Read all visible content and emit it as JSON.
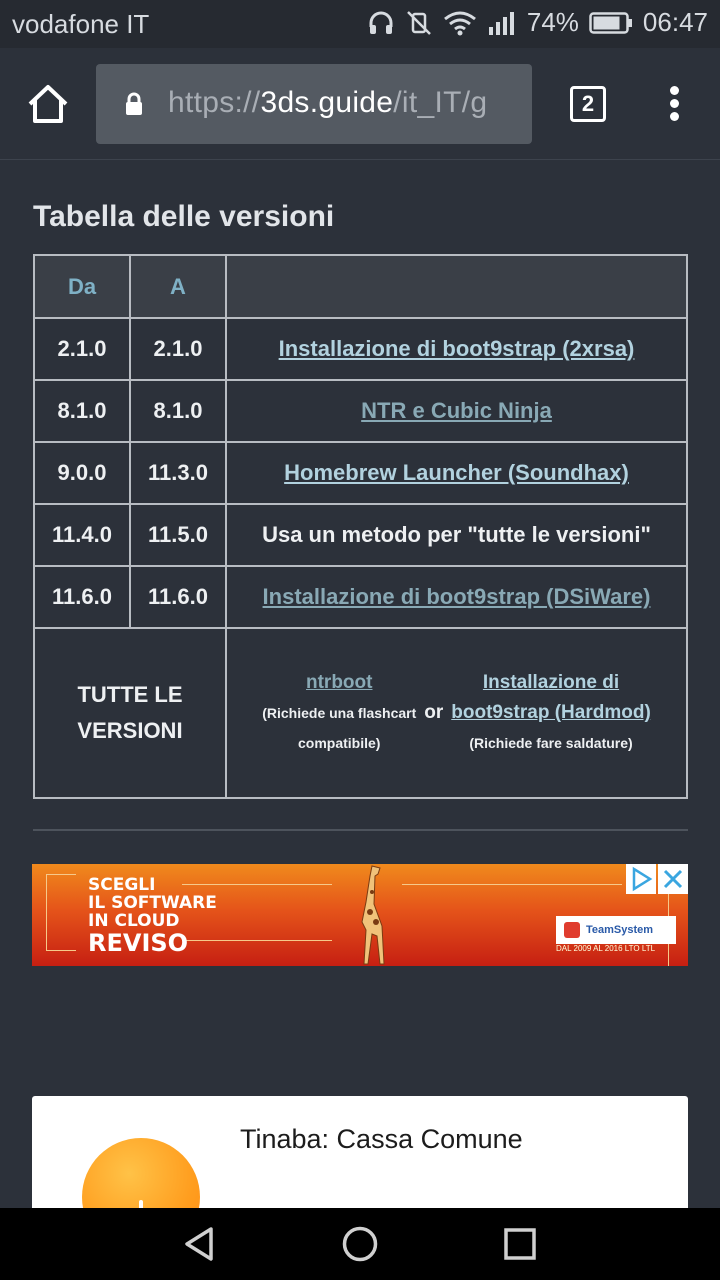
{
  "status_bar": {
    "carrier": "vodafone IT",
    "battery": "74%",
    "time": "06:47",
    "icons": [
      "headphones-icon",
      "vibrate-off-icon",
      "wifi-icon",
      "signal-icon",
      "battery-icon"
    ]
  },
  "browser": {
    "url_scheme": "https://",
    "url_host": "3ds.guide",
    "url_path": "/it_IT/g",
    "tab_count": "2"
  },
  "content": {
    "section_title": "Tabella delle versioni",
    "table": {
      "headers": [
        "Da",
        "A",
        ""
      ],
      "rows": [
        {
          "from": "2.1.0",
          "to": "2.1.0",
          "method": "Installazione di boot9strap (2xrsa)"
        },
        {
          "from": "8.1.0",
          "to": "8.1.0",
          "method": "NTR e Cubic Ninja"
        },
        {
          "from": "9.0.0",
          "to": "11.3.0",
          "method": "Homebrew Launcher (Soundhax)"
        },
        {
          "from": "11.4.0",
          "to": "11.5.0",
          "method": "Usa un metodo per \"tutte le versioni\""
        },
        {
          "from": "11.6.0",
          "to": "11.6.0",
          "method": "Installazione di boot9strap (DSiWare)"
        }
      ],
      "all_versions": {
        "label_line1": "TUTTE LE",
        "label_line2": "VERSIONI",
        "option1_link": "ntrboot",
        "option1_note_line1": "(Richiede una flashcart",
        "option1_note_line2": "compatibile)",
        "or": "or",
        "option2_link_line1": "Installazione di",
        "option2_link_line2": "boot9strap (Hardmod)",
        "option2_note": "(Richiede fare saldature)"
      }
    }
  },
  "ad": {
    "line1": "SCEGLI",
    "line2": "IL SOFTWARE",
    "line3": "IN CLOUD",
    "line4": "REVISO",
    "brand": "TeamSystem",
    "brand_sub": "DAL 2009 AL 2016 LTO LTL"
  },
  "card": {
    "title": "Tinaba: Cassa Comune"
  }
}
